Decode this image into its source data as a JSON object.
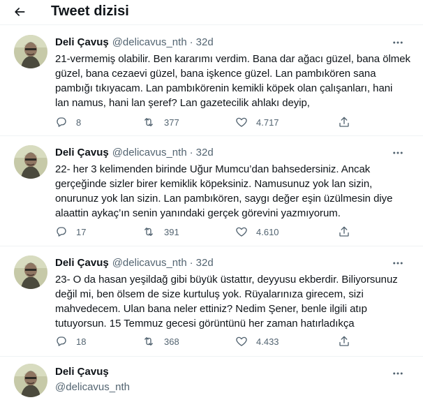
{
  "header": {
    "title": "Tweet dizisi"
  },
  "tweets": [
    {
      "name": "Deli Çavuş",
      "handle": "@delicavus_nth",
      "dot": "·",
      "time": "32d",
      "lines": [
        "21-vermemiş olabilir. Ben kararımı verdim. Bana dar ağacı güzel, bana ölmek",
        "güzel, bana cezaevi güzel, bana işkence güzel. Lan pambıkören sana",
        "pambığı tıkıyacam. Lan pambıkörenin kemikli köpek olan çalışanları, hani",
        "lan namus, hani lan şeref? Lan gazetecilik ahlakı deyip,"
      ],
      "replies": "8",
      "retweets": "377",
      "likes": "4.717"
    },
    {
      "name": "Deli Çavuş",
      "handle": "@delicavus_nth",
      "dot": "·",
      "time": "32d",
      "lines": [
        "22- her 3 kelimenden birinde Uğur Mumcu’dan bahsedersiniz. Ancak",
        "gerçeğinde sizler birer kemiklik köpeksiniz. Namusunuz yok lan sizin,",
        "onurunuz yok lan sizin. Lan pambıkören, saygı değer eşin üzülmesin diye",
        "alaattin aykaç’ın senin yanındaki gerçek görevini yazmıyorum."
      ],
      "replies": "17",
      "retweets": "391",
      "likes": "4.610"
    },
    {
      "name": "Deli Çavuş",
      "handle": "@delicavus_nth",
      "dot": "·",
      "time": "32d",
      "lines": [
        "23- O da hasan yeşildağ gibi büyük üstattır, deyyusu ekberdir. Biliyorsunuz",
        "değil mi, ben ölsem de size kurtuluş yok. Rüyalarınıza girecem, sizi",
        "mahvedecem. Ulan bana neler ettiniz? Nedim Şener, benle ilgili atıp",
        "tutuyorsun. 15 Temmuz gecesi görüntünü her zaman hatırladıkça"
      ],
      "replies": "18",
      "retweets": "368",
      "likes": "4.433"
    }
  ],
  "last_tweet": {
    "name": "Deli Çavuş",
    "handle": "@delicavus_nth"
  },
  "icons": {
    "back": "arrow-left-icon",
    "more": "more-horizontal-icon",
    "reply": "reply-icon",
    "retweet": "retweet-icon",
    "like": "heart-icon",
    "share": "share-icon"
  },
  "colors": {
    "text": "#0f1419",
    "secondary": "#536471",
    "divider": "#eff3f4"
  }
}
